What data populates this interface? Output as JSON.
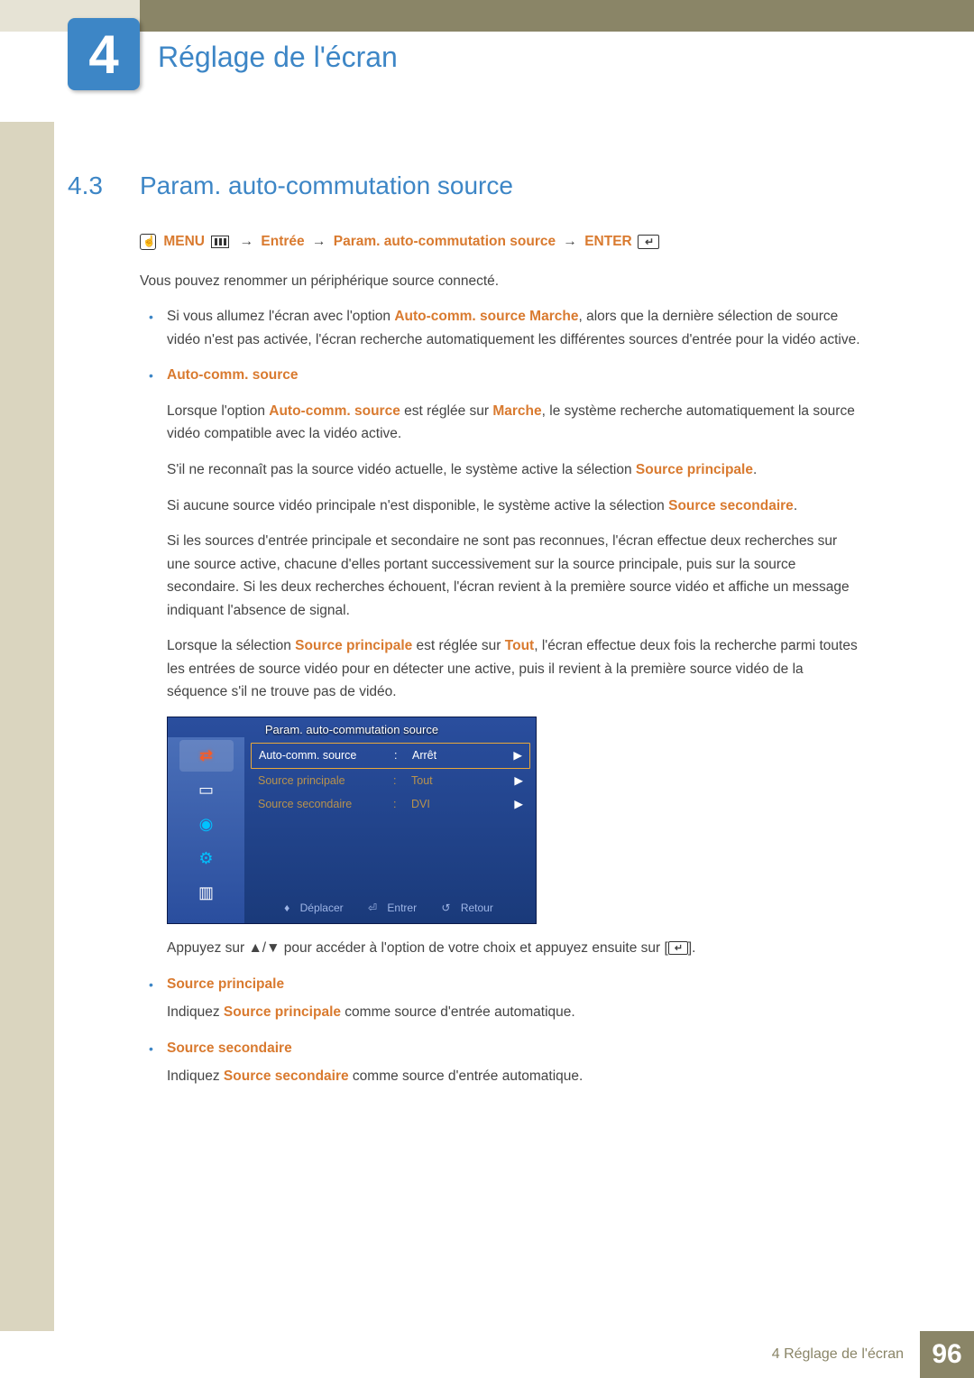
{
  "chapter": {
    "number": "4",
    "title": "Réglage de l'écran"
  },
  "section": {
    "number": "4.3",
    "title": "Param. auto-commutation source"
  },
  "navpath": {
    "menu": "MENU",
    "step1": "Entrée",
    "step2": "Param. auto-commutation source",
    "enter": "ENTER",
    "arrow": "→"
  },
  "intro": "Vous pouvez renommer un périphérique source connecté.",
  "bullet1": {
    "pre": "Si vous allumez l'écran avec l'option ",
    "emph": "Auto-comm. source Marche",
    "post": ", alors que la dernière sélection de source vidéo n'est pas activée, l'écran recherche automatiquement les différentes sources d'entrée pour la vidéo active."
  },
  "autocomm": {
    "title": "Auto-comm. source",
    "p1_a": "Lorsque l'option ",
    "p1_e1": "Auto-comm. source",
    "p1_b": " est réglée sur ",
    "p1_e2": "Marche",
    "p1_c": ", le système recherche automatiquement la source vidéo compatible avec la vidéo active.",
    "p2_a": "S'il ne reconnaît pas la source vidéo actuelle, le système active la sélection ",
    "p2_e": "Source principale",
    "p2_b": ".",
    "p3_a": "Si aucune source vidéo principale n'est disponible, le système active la sélection ",
    "p3_e": "Source secondaire",
    "p3_b": ".",
    "p4": "Si les sources d'entrée principale et secondaire ne sont pas reconnues, l'écran effectue deux recherches sur une source active, chacune d'elles portant successivement sur la source principale, puis sur la source secondaire. Si les deux recherches échouent, l'écran revient à la première source vidéo et affiche un message indiquant l'absence de signal.",
    "p5_a": "Lorsque la sélection ",
    "p5_e1": "Source principale",
    "p5_b": " est réglée sur ",
    "p5_e2": "Tout",
    "p5_c": ", l'écran effectue deux fois la recherche parmi toutes les entrées de source vidéo pour en détecter une active, puis il revient à la première source vidéo de la séquence s'il ne trouve pas de vidéo."
  },
  "osd": {
    "title": "Param. auto-commutation source",
    "rows": [
      {
        "label": "Auto-comm. source",
        "value": "Arrêt",
        "selected": true
      },
      {
        "label": "Source principale",
        "value": "Tout",
        "selected": false
      },
      {
        "label": "Source secondaire",
        "value": "DVI",
        "selected": false
      }
    ],
    "footer": {
      "move": "Déplacer",
      "enter": "Entrer",
      "return": "Retour"
    }
  },
  "postosd": {
    "a": "Appuyez sur ",
    "keys": "▲/▼",
    "b": " pour accéder à l'option de votre choix et appuyez ensuite sur [",
    "c": "]."
  },
  "sp": {
    "title": "Source principale",
    "a": "Indiquez ",
    "e": "Source principale",
    "b": " comme source d'entrée automatique."
  },
  "ss": {
    "title": "Source secondaire",
    "a": "Indiquez ",
    "e": "Source secondaire",
    "b": " comme source d'entrée automatique."
  },
  "footer": {
    "label": "4 Réglage de l'écran",
    "page": "96"
  }
}
